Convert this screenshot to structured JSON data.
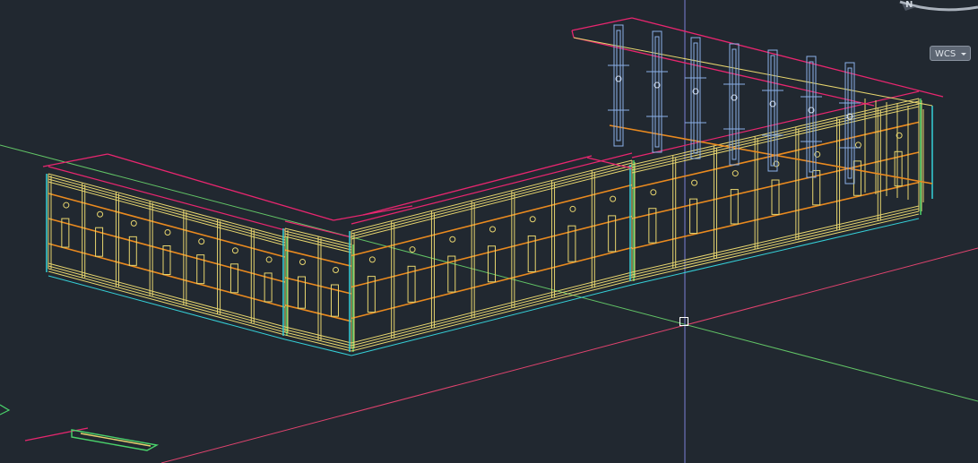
{
  "ucs_menu": {
    "label": "WCS"
  },
  "viewcube": {
    "compass_letter": "N"
  },
  "colors": {
    "background": "#212830",
    "wall_lines": "#e7d56e",
    "beam_lines": "#ea8a1f",
    "column_lines": "#35d0d8",
    "accent_lines": "#4ad26b",
    "outline_lines": "#e8266f",
    "bracket_lines": "#8ab0e8",
    "axis_x": "#e0436e",
    "axis_y": "#62c466",
    "axis_z": "#7a7fd6",
    "cursor": "#ffffff"
  }
}
